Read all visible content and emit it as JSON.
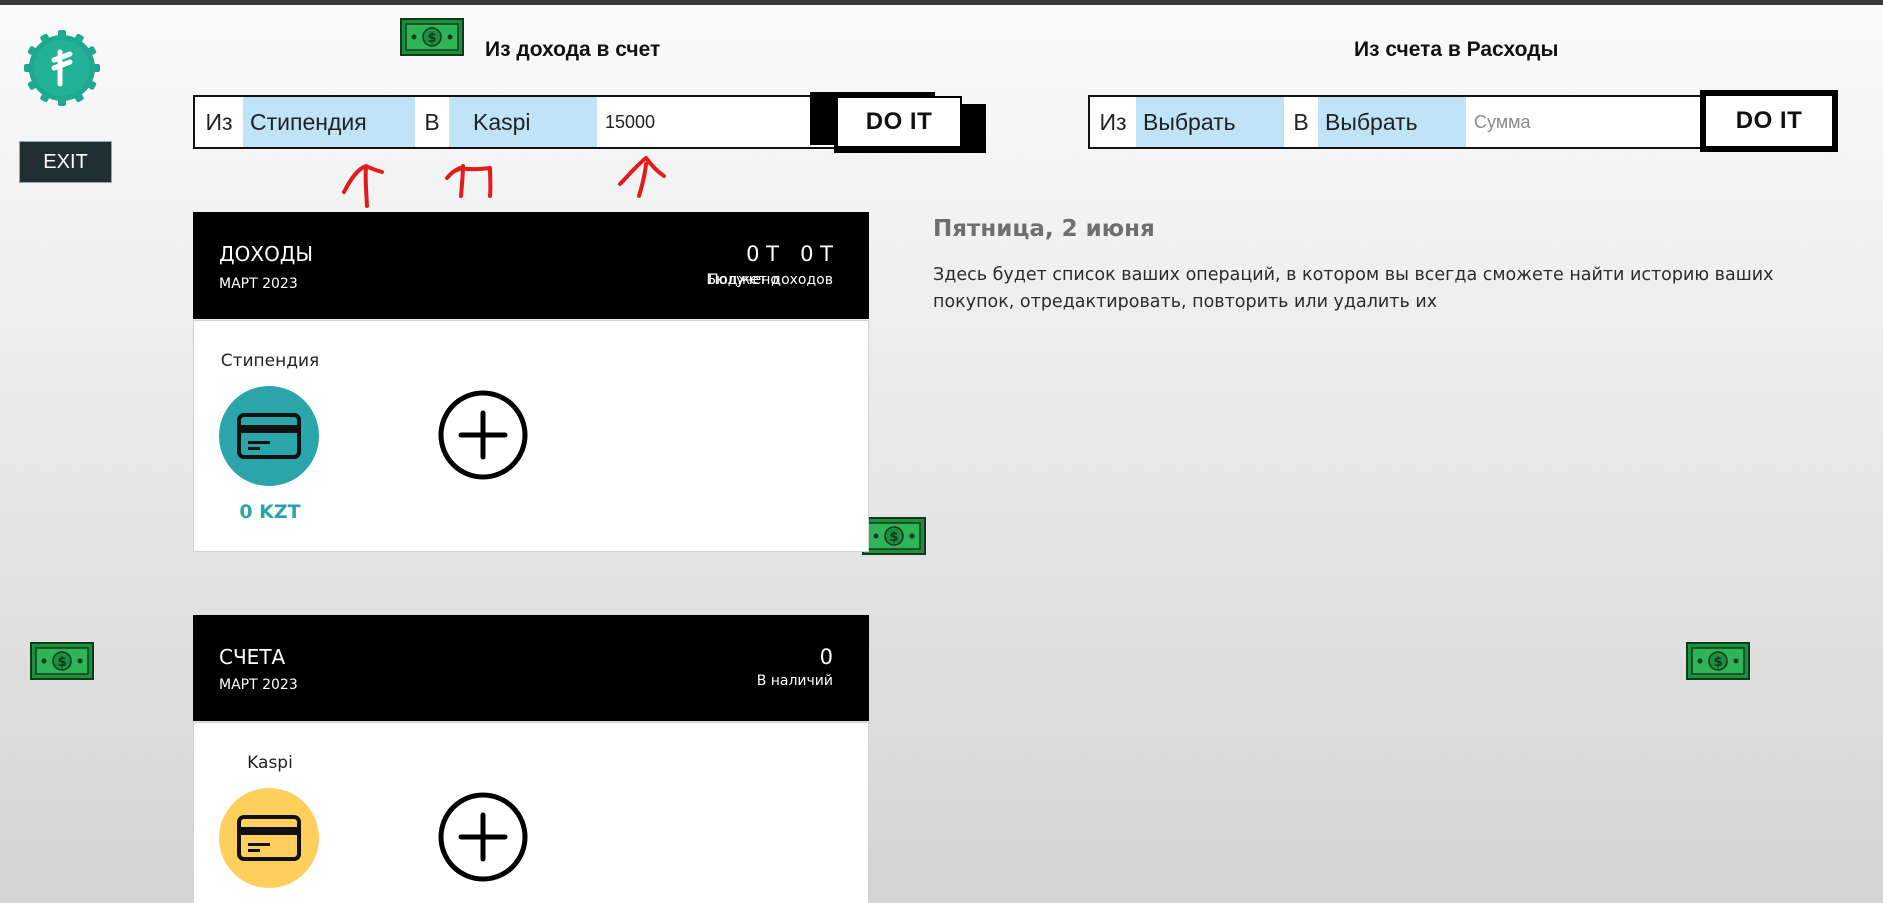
{
  "header": {
    "exit_label": "EXIT"
  },
  "income_transfer": {
    "title": "Из дохода в счет",
    "from_label": "Из",
    "from_value": "Стипендия",
    "to_label": "В",
    "to_value": "Kaspi",
    "amount_value": "15000",
    "submit_label": "DO IT"
  },
  "expense_transfer": {
    "title": "Из счета в Расходы",
    "from_label": "Из",
    "from_value": "Выбрать",
    "to_label": "В",
    "to_value": "Выбрать",
    "amount_placeholder": "Сумма",
    "submit_label": "DO IT"
  },
  "income_panel": {
    "title": "ДОХОДЫ",
    "period": "МАРТ 2023",
    "received_value": "0 Т",
    "received_label": "Получено",
    "budget_value": "0 Т",
    "budget_label": "Бюджет доходов",
    "item": {
      "name": "Стипендия",
      "amount": "0 KZT",
      "color": "#2aa6aa"
    }
  },
  "accounts_panel": {
    "title": "СЧЕТА",
    "period": "МАРТ 2023",
    "cash_value": "0",
    "cash_label": "В наличий",
    "item": {
      "name": "Kaspi",
      "color": "#ffcf5e"
    }
  },
  "operations": {
    "date": "Пятница, 2 июня",
    "empty_text": "Здесь будет список ваших операций, в котором вы всегда сможете найти историю ваших покупок, отредактировать, повторить или удалить их"
  },
  "icons": {
    "logo": "tenge-logo-icon",
    "money": "money-bill-icon",
    "card": "credit-card-icon",
    "add": "plus-circle-icon",
    "annotation": "red-arrow-icon"
  },
  "colors": {
    "accent_teal": "#2aa6aa",
    "select_bg": "#bfe3f7",
    "kaspi_yellow": "#ffcf5e",
    "annotation_red": "#e21b1b"
  }
}
